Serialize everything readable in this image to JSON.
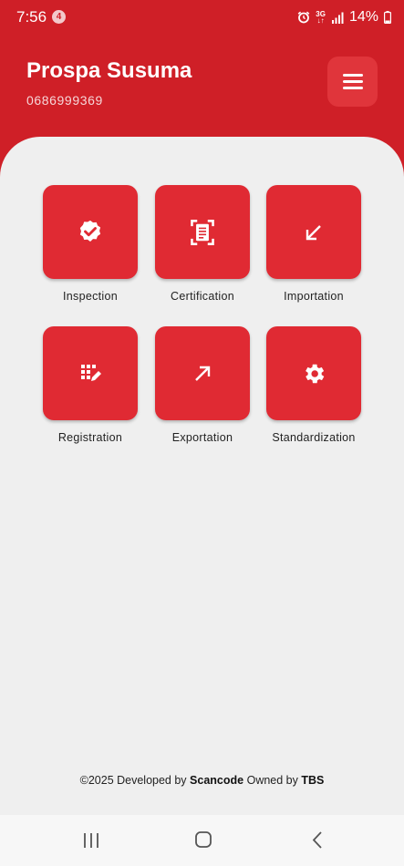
{
  "status_bar": {
    "time": "7:56",
    "notification_count": "4",
    "network": "3G",
    "battery": "14%"
  },
  "header": {
    "name": "Prospa Susuma",
    "phone": "0686999369",
    "color": "#cf1f27"
  },
  "tiles": [
    {
      "label": "Inspection",
      "icon": "verified-badge-icon"
    },
    {
      "label": "Certification",
      "icon": "document-scan-icon"
    },
    {
      "label": "Importation",
      "icon": "arrow-down-left-icon"
    },
    {
      "label": "Registration",
      "icon": "grid-edit-icon"
    },
    {
      "label": "Exportation",
      "icon": "arrow-up-right-icon"
    },
    {
      "label": "Standardization",
      "icon": "gear-icon"
    }
  ],
  "footer": {
    "prefix": "©2025 Developed by",
    "developer": "Scancode",
    "owned_by": "Owned by",
    "owner": "TBS"
  },
  "accent_color": "#e02a33"
}
